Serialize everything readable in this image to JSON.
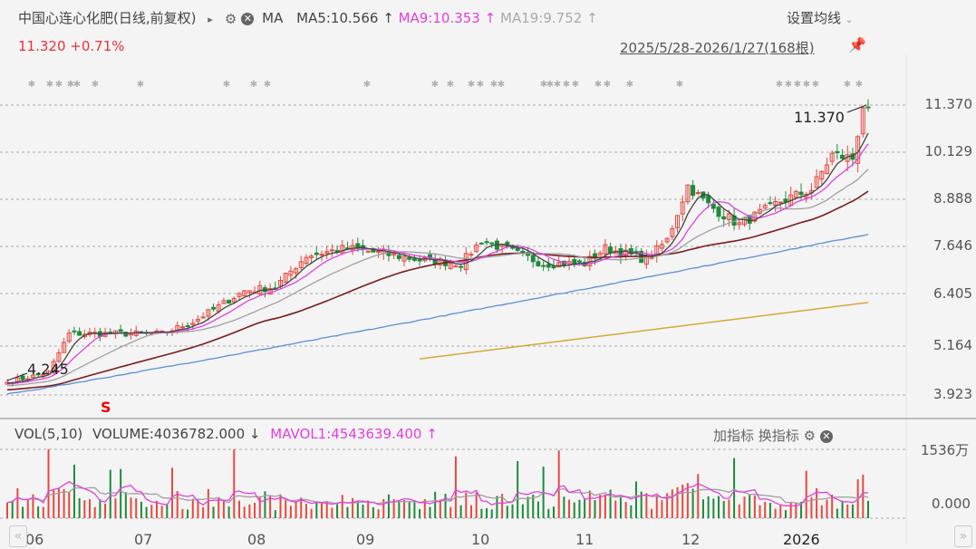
{
  "header": {
    "title": "中国心连心化肥(日线,前复权)",
    "play_icon": "▸",
    "ma_label": "MA",
    "ma5": "MA5:10.566",
    "ma5_arrow": "↑",
    "ma9": "MA9:10.353",
    "ma9_arrow": "↑",
    "ma19": "MA19:9.752",
    "ma19_arrow": "↑",
    "settings_label": "设置均线",
    "price": "11.320",
    "change": "+0.71%",
    "range": "2025/5/28-2026/1/27(168根)"
  },
  "price_axis": [
    "11.370",
    "10.129",
    "8.888",
    "7.646",
    "6.405",
    "5.164",
    "3.923"
  ],
  "annotations": {
    "high": "11.370",
    "low": "4.245",
    "signal": "S"
  },
  "volume_panel": {
    "label": "VOL(5,10)",
    "volume": "VOLUME:4036782.000",
    "volume_arrow": "↓",
    "mavol": "MAVOL1:4543639.400",
    "mavol_arrow": "↑",
    "add_indicator": "加指标",
    "switch_indicator": "换指标",
    "axis_top": "1536万",
    "axis_bottom": "0.000"
  },
  "x_axis": [
    "06",
    "07",
    "08",
    "09",
    "10",
    "11",
    "12",
    "2026"
  ],
  "colors": {
    "up": "#e8483f",
    "down": "#1e8a3c",
    "ma5": "#444444",
    "ma9": "#e040e0",
    "ma19": "#a0a0a0",
    "ma40": "#7a1c1c",
    "ma_long": "#5b8fd6",
    "ma_longer": "#d4a93a"
  },
  "chart_data": {
    "type": "candlestick",
    "bars": 168,
    "ylim": [
      3.923,
      11.37
    ],
    "close_keypoints": [
      [
        0,
        4.25
      ],
      [
        8,
        4.5
      ],
      [
        12,
        5.5
      ],
      [
        20,
        5.5
      ],
      [
        30,
        5.5
      ],
      [
        36,
        5.8
      ],
      [
        46,
        6.6
      ],
      [
        52,
        6.7
      ],
      [
        58,
        7.5
      ],
      [
        66,
        7.7
      ],
      [
        80,
        7.4
      ],
      [
        88,
        7.3
      ],
      [
        92,
        7.9
      ],
      [
        98,
        7.6
      ],
      [
        104,
        7.3
      ],
      [
        112,
        7.3
      ],
      [
        116,
        7.7
      ],
      [
        124,
        7.4
      ],
      [
        128,
        7.9
      ],
      [
        132,
        9.3
      ],
      [
        136,
        8.8
      ],
      [
        142,
        8.3
      ],
      [
        150,
        8.9
      ],
      [
        156,
        9.2
      ],
      [
        160,
        10.1
      ],
      [
        164,
        10.0
      ],
      [
        166,
        11.3
      ],
      [
        167,
        11.32
      ]
    ],
    "long_ma": {
      "start": 3.95,
      "end": 8.05
    },
    "longer_ma": {
      "start_bar": 80,
      "start": 4.85,
      "end": 6.3
    },
    "volume_max_wan": 1536
  }
}
